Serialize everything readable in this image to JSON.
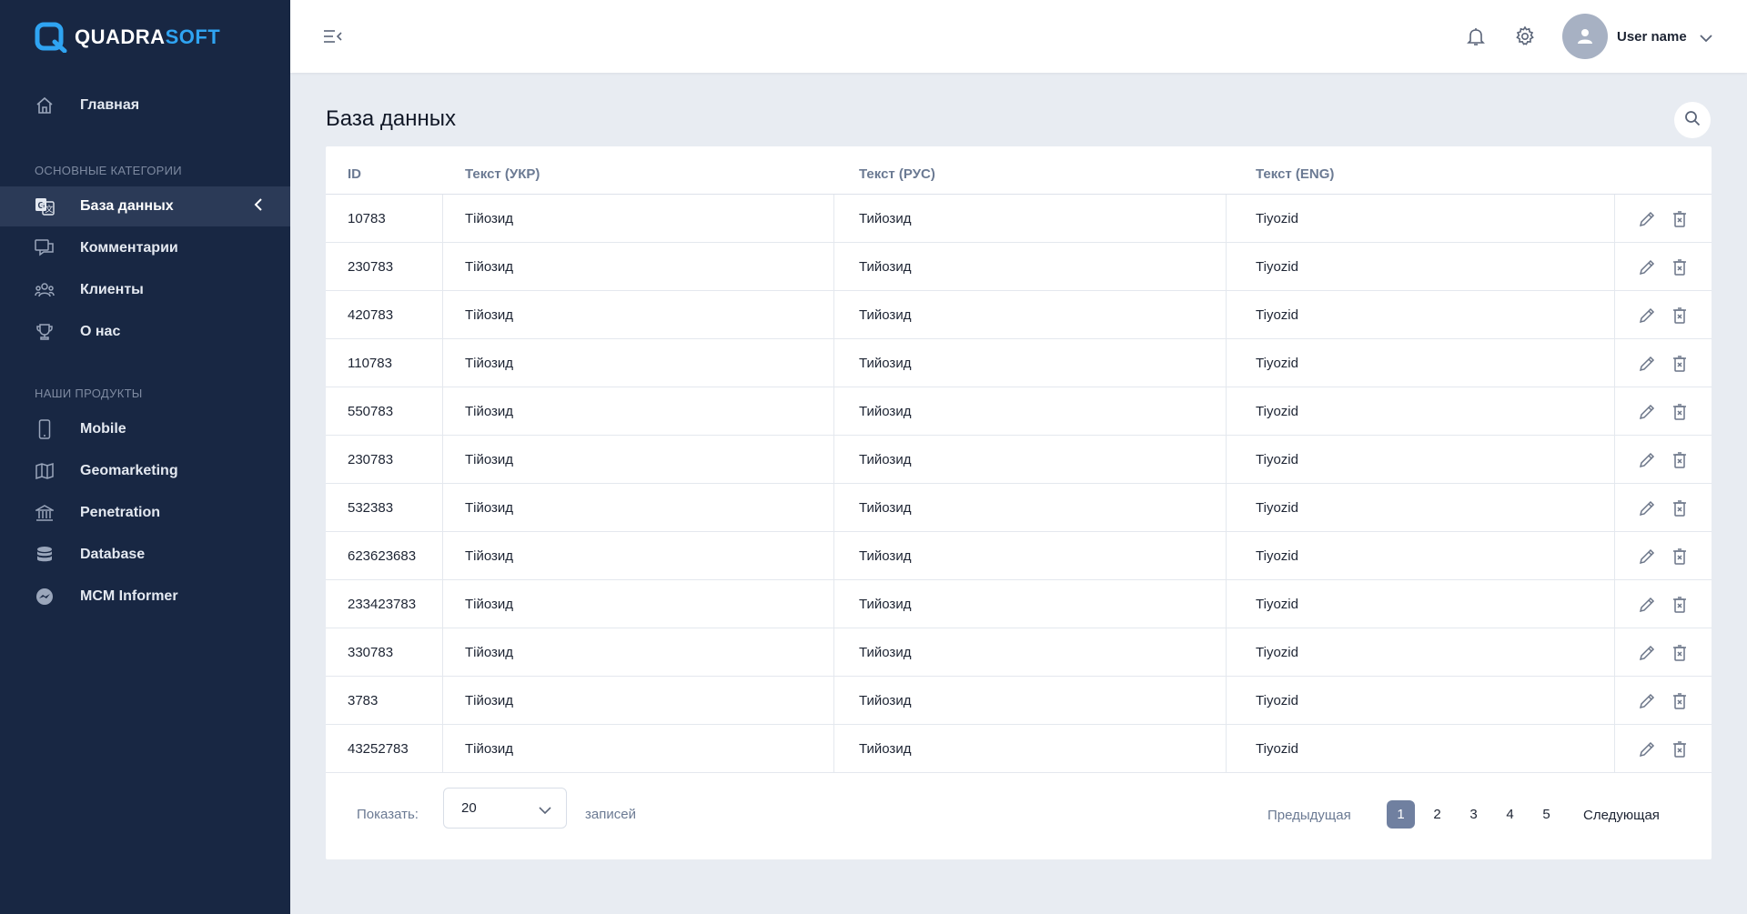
{
  "brand": {
    "name_part1": "QUADRA",
    "name_part2": "SOFT",
    "accent": "#2fa4f2"
  },
  "sidebar": {
    "home": {
      "label": "Главная",
      "icon": "home-icon"
    },
    "section1_title": "ОСНОВНЫЕ КАТЕГОРИИ",
    "section1_items": [
      {
        "label": "База данных",
        "icon": "translate-icon",
        "active": true
      },
      {
        "label": "Комментарии",
        "icon": "comments-icon"
      },
      {
        "label": "Клиенты",
        "icon": "users-icon"
      },
      {
        "label": "О нас",
        "icon": "trophy-icon"
      }
    ],
    "section2_title": "НАШИ ПРОДУКТЫ",
    "section2_items": [
      {
        "label": "Mobile",
        "icon": "mobile-icon"
      },
      {
        "label": "Geomarketing",
        "icon": "map-icon"
      },
      {
        "label": "Penetration",
        "icon": "bank-icon"
      },
      {
        "label": "Database",
        "icon": "database-icon"
      },
      {
        "label": "MCM Informer",
        "icon": "messenger-icon"
      }
    ]
  },
  "topbar": {
    "username": "User name"
  },
  "page": {
    "title": "База данных"
  },
  "table": {
    "columns": [
      "ID",
      "Текст (УКР)",
      "Текст (РУС)",
      "Текст (ENG)"
    ],
    "rows": [
      [
        "10783",
        "Тійозид",
        "Тийозид",
        "Tiyozid"
      ],
      [
        "230783",
        "Тійозид",
        "Тийозид",
        "Tiyozid"
      ],
      [
        "420783",
        "Тійозид",
        "Тийозид",
        "Tiyozid"
      ],
      [
        "110783",
        "Тійозид",
        "Тийозид",
        "Tiyozid"
      ],
      [
        "550783",
        "Тійозид",
        "Тийозид",
        "Tiyozid"
      ],
      [
        "230783",
        "Тійозид",
        "Тийозид",
        "Tiyozid"
      ],
      [
        "532383",
        "Тійозид",
        "Тийозид",
        "Tiyozid"
      ],
      [
        "623623683",
        "Тійозид",
        "Тийозид",
        "Tiyozid"
      ],
      [
        "233423783",
        "Тійозид",
        "Тийозид",
        "Tiyozid"
      ],
      [
        "330783",
        "Тійозид",
        "Тийозид",
        "Tiyozid"
      ],
      [
        "3783",
        "Тійозид",
        "Тийозид",
        "Tiyozid"
      ],
      [
        "43252783",
        "Тійозид",
        "Тийозид",
        "Tiyozid"
      ]
    ]
  },
  "footer": {
    "show_label": "Показать:",
    "page_size": "20",
    "records_label": "записей",
    "prev_label": "Предыдущая",
    "next_label": "Следующая",
    "pages": [
      "1",
      "2",
      "3",
      "4",
      "5"
    ],
    "current_page": "1"
  }
}
